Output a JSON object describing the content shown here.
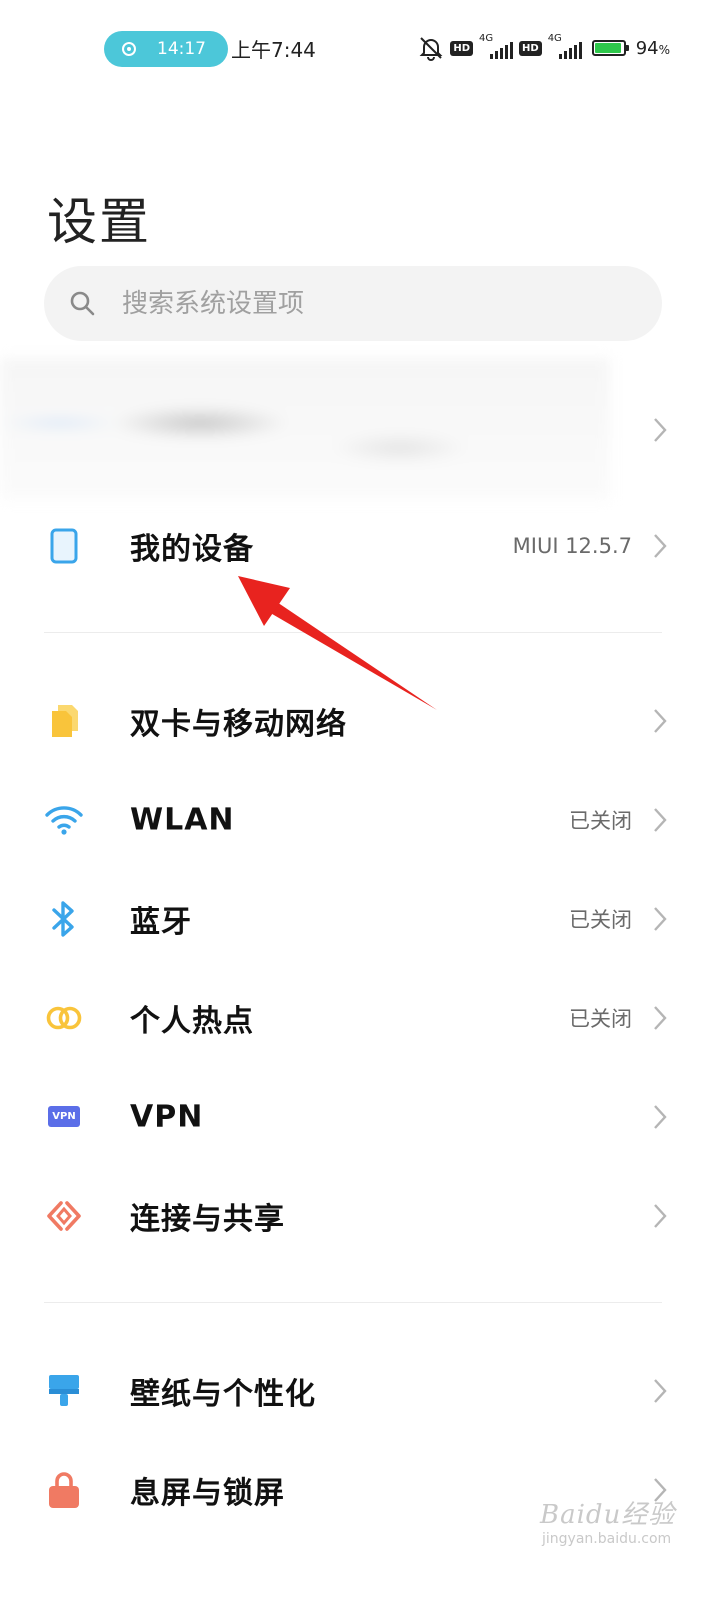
{
  "status_bar": {
    "timer": "14:17",
    "time": "上午7:44",
    "hd_label": "HD",
    "network_label": "4G",
    "battery_value": "94",
    "battery_unit": "%"
  },
  "page_title": "设置",
  "search": {
    "placeholder": "搜索系统设置项"
  },
  "my_device": {
    "label": "我的设备",
    "value": "MIUI 12.5.7"
  },
  "network_section": [
    {
      "label": "双卡与移动网络",
      "value": "",
      "icon": "sim-cards-icon"
    },
    {
      "label": "WLAN",
      "value": "已关闭",
      "icon": "wifi-icon"
    },
    {
      "label": "蓝牙",
      "value": "已关闭",
      "icon": "bluetooth-icon"
    },
    {
      "label": "个人热点",
      "value": "已关闭",
      "icon": "hotspot-icon"
    },
    {
      "label": "VPN",
      "value": "",
      "icon": "vpn-icon",
      "icon_text": "VPN"
    },
    {
      "label": "连接与共享",
      "value": "",
      "icon": "connection-sharing-icon"
    }
  ],
  "personal_section": [
    {
      "label": "壁纸与个性化",
      "icon": "wallpaper-icon"
    },
    {
      "label": "息屏与锁屏",
      "icon": "lock-icon"
    }
  ],
  "watermark": {
    "logo": "Baidu经验",
    "sub": "jingyan.baidu.com"
  },
  "colors": {
    "timer_pill": "#4cc7d9",
    "icon_blue": "#3aa5ea",
    "icon_yellow": "#f9c43b",
    "icon_vpn": "#5b6ee8",
    "icon_coral": "#f07a63",
    "annotation_arrow": "#e8231f"
  }
}
